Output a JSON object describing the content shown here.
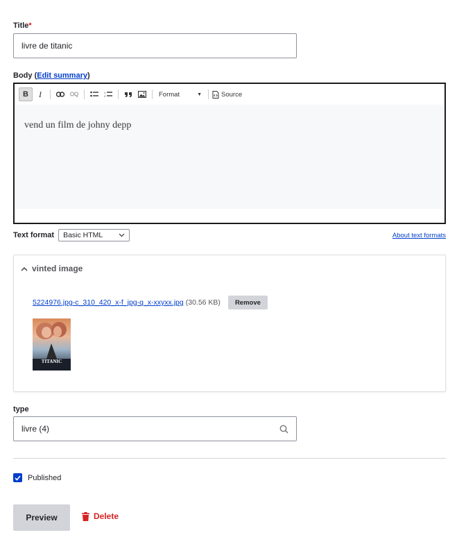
{
  "title_field": {
    "label": "Title",
    "required_marker": "*",
    "value": "livre de titanic"
  },
  "body_field": {
    "label": "Body",
    "summary_prefix": "(",
    "summary_link": "Edit summary",
    "summary_suffix": ")",
    "toolbar": {
      "bold": "B",
      "italic": "I",
      "format_label": "Format",
      "source_label": "Source"
    },
    "content": "vend un film de johny depp"
  },
  "text_format": {
    "label": "Text format",
    "selected": "Basic HTML",
    "about_link": "About text formats"
  },
  "image_section": {
    "summary": "vinted image",
    "file_name": "5224976.jpg-c_310_420_x-f_jpg-q_x-xxyxx.jpg",
    "file_size": "(30.56 KB)",
    "remove_label": "Remove",
    "poster_text": "TITANIC"
  },
  "type_field": {
    "label": "type",
    "value": "livre (4)"
  },
  "published": {
    "label": "Published",
    "checked": true
  },
  "actions": {
    "preview_label": "Preview",
    "delete_label": "Delete"
  },
  "colors": {
    "link": "#003ecc",
    "danger": "#d72222",
    "button_bg": "#d3d4d9",
    "checkbox": "#003ecc"
  }
}
